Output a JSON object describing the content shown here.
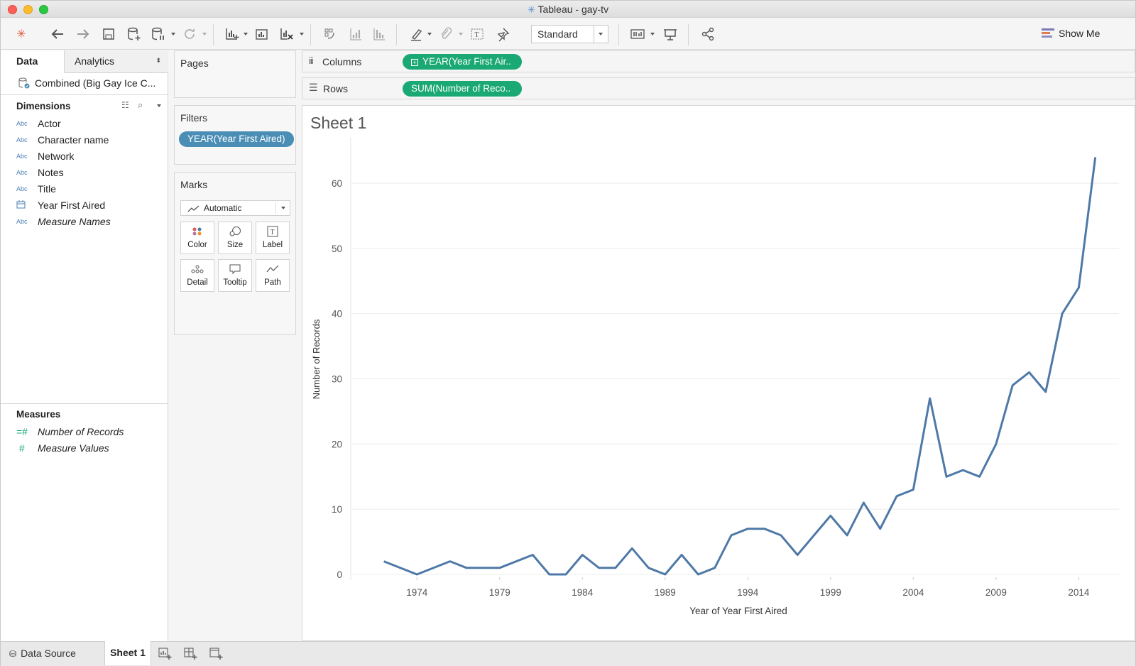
{
  "window": {
    "title": "Tableau - gay-tv"
  },
  "toolbar": {
    "standard_label": "Standard",
    "showme_label": "Show Me"
  },
  "left": {
    "tab_data": "Data",
    "tab_analytics": "Analytics",
    "datasource": "Combined (Big Gay Ice C...",
    "dimensions_title": "Dimensions",
    "dimensions": [
      {
        "icon": "Abc",
        "label": "Actor"
      },
      {
        "icon": "Abc",
        "label": "Character name"
      },
      {
        "icon": "Abc",
        "label": "Network"
      },
      {
        "icon": "Abc",
        "label": "Notes"
      },
      {
        "icon": "Abc",
        "label": "Title"
      },
      {
        "icon": "calendar-icon",
        "label": "Year First Aired"
      },
      {
        "icon": "Abc",
        "label": "Measure Names"
      }
    ],
    "measures_title": "Measures",
    "measures": [
      {
        "icon": "hash-icon",
        "label": "Number of Records"
      },
      {
        "icon": "hash-icon",
        "label": "Measure Values"
      }
    ]
  },
  "cards": {
    "pages": "Pages",
    "filters": "Filters",
    "filter_pill": "YEAR(Year First Aired)",
    "marks": "Marks",
    "mark_type": "Automatic",
    "mark_buttons": [
      "Color",
      "Size",
      "Label",
      "Detail",
      "Tooltip",
      "Path"
    ]
  },
  "shelves": {
    "columns_label": "Columns",
    "columns_pill": "YEAR(Year First Air..",
    "rows_label": "Rows",
    "rows_pill": "SUM(Number of Reco.."
  },
  "sheet": {
    "title": "Sheet 1"
  },
  "bottom": {
    "datasource_tab": "Data Source",
    "sheet_tab": "Sheet 1"
  },
  "colors": {
    "line": "#4e79a7",
    "pill_green": "#1aa874",
    "pill_blue": "#4a8db5"
  },
  "chart_data": {
    "type": "line",
    "title": "Sheet 1",
    "xlabel": "Year of Year First Aired",
    "ylabel": "Number of Records",
    "xlim": [
      1970,
      2016
    ],
    "ylim": [
      0,
      66
    ],
    "xticks": [
      1974,
      1979,
      1984,
      1989,
      1994,
      1999,
      2004,
      2009,
      2014
    ],
    "yticks": [
      0,
      10,
      20,
      30,
      40,
      50,
      60
    ],
    "grid": true,
    "series": [
      {
        "x": [
          1972,
          1974,
          1976,
          1977,
          1979,
          1981,
          1982,
          1983,
          1984,
          1985,
          1986,
          1987,
          1988,
          1989,
          1990,
          1991,
          1992,
          1993,
          1994,
          1995,
          1996,
          1997,
          1998,
          1999,
          2000,
          2001,
          2002,
          2003,
          2004,
          2005,
          2006,
          2007,
          2008,
          2009,
          2010,
          2011,
          2012,
          2013,
          2014,
          2015
        ],
        "y": [
          2,
          0,
          2,
          1,
          1,
          3,
          0,
          0,
          3,
          1,
          1,
          4,
          1,
          0,
          3,
          0,
          1,
          6,
          7,
          7,
          6,
          3,
          6,
          9,
          6,
          11,
          7,
          12,
          13,
          27,
          15,
          16,
          15,
          20,
          29,
          31,
          28,
          40,
          44,
          64
        ]
      }
    ]
  }
}
